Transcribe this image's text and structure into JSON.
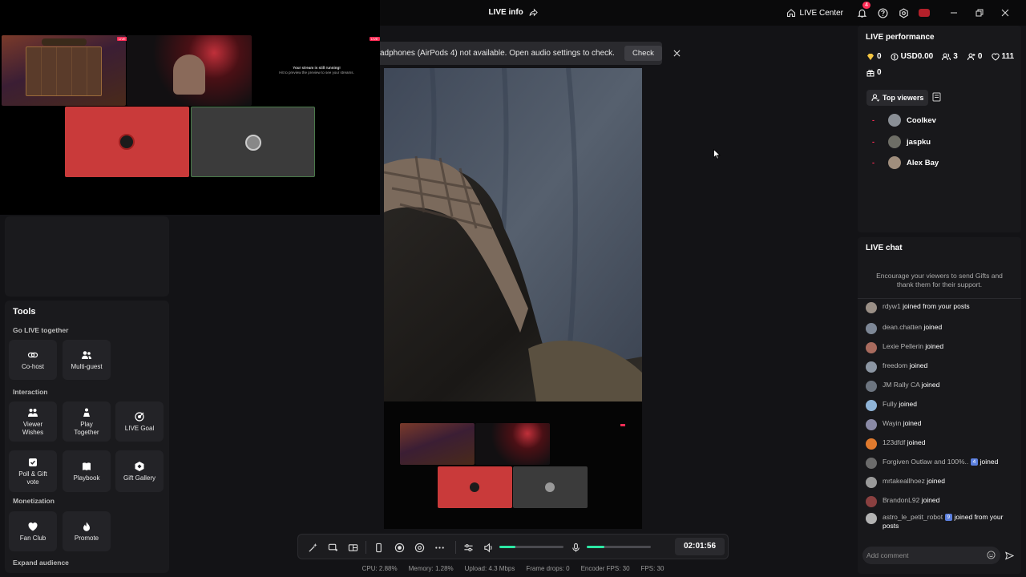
{
  "titlebar": {
    "title": "LIVE info",
    "live_center": "LIVE Center",
    "notification_count": "4",
    "icons": [
      "share-icon",
      "home-icon",
      "bell-icon",
      "help-icon",
      "settings-icon",
      "avatar",
      "minimize-icon",
      "restore-icon",
      "close-icon"
    ]
  },
  "preview": {
    "stream_message_title": "Your stream is still running!",
    "stream_message_body": "Hit to preview the preview to see your streams.",
    "live_tag": "LIVE"
  },
  "notice": {
    "text": "adphones (AirPods 4) not available. Open audio settings to check.",
    "check": "Check"
  },
  "tools": {
    "title": "Tools",
    "sections": {
      "go_live": "Go LIVE together",
      "interaction": "Interaction",
      "monetization": "Monetization",
      "expand": "Expand audience"
    },
    "items": {
      "cohost": "Co-host",
      "multiguest": "Multi-guest",
      "viewer_wishes": "Viewer Wishes",
      "play_together": "Play Together",
      "live_goal": "LIVE Goal",
      "poll_gift": "Poll & Gift vote",
      "playbook": "Playbook",
      "gift_gallery": "Gift Gallery",
      "fan_club": "Fan Club",
      "promote": "Promote"
    }
  },
  "controls": {
    "timer": "02:01:56",
    "volume_level": 0.25,
    "mic_level": 0.27
  },
  "stats": {
    "cpu": "CPU: 2.88%",
    "memory": "Memory: 1.28%",
    "upload": "Upload: 4.3 Mbps",
    "frame_drops": "Frame drops: 0",
    "encoder_fps": "Encoder FPS: 30",
    "fps": "FPS: 30"
  },
  "performance": {
    "title": "LIVE performance",
    "diamonds": "0",
    "usd": "USD0.00",
    "viewers": "3",
    "new_followers": "0",
    "likes": "111",
    "gifts": "0",
    "top_viewers_tab": "Top viewers",
    "top_viewers": [
      "Coolkev",
      "jaspku",
      "Alex Bay"
    ]
  },
  "chat": {
    "title": "LIVE chat",
    "hint": "Encourage your viewers to send Gifts and thank them for their support.",
    "placeholder": "Add comment",
    "messages": [
      {
        "user": "rdyw1",
        "msg": "joined from your posts"
      },
      {
        "user": "dean.chatten",
        "msg": "joined"
      },
      {
        "user": "Lexie Pellerin",
        "msg": "joined"
      },
      {
        "user": "freedom",
        "msg": "joined"
      },
      {
        "user": "JM Rally CA",
        "msg": "joined"
      },
      {
        "user": "Fully",
        "msg": "joined"
      },
      {
        "user": "Wayin",
        "msg": "joined"
      },
      {
        "user": "123dfdf",
        "msg": "joined"
      },
      {
        "user": "Forgiven Outlaw and 100%..",
        "level": "4",
        "msg": "joined"
      },
      {
        "user": "mrtakeallhoez",
        "msg": "joined"
      },
      {
        "user": "BrandonL92",
        "msg": "joined"
      },
      {
        "user": "astro_le_petit_robot",
        "level": "9",
        "msg": "joined from your posts"
      }
    ]
  },
  "colors": {
    "accent_red": "#fe2c55",
    "slider_green": "#2ce8a4",
    "panel": "#18181b",
    "background": "#131316"
  }
}
